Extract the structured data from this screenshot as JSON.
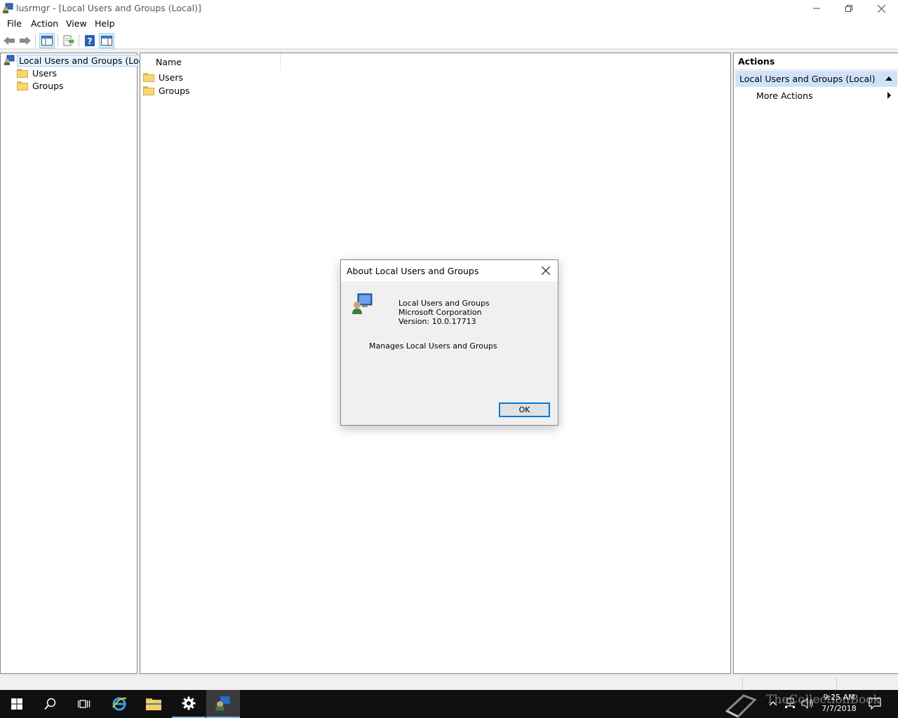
{
  "window": {
    "title": "lusrmgr - [Local Users and Groups (Local)]",
    "icon": "lusrmgr-app-icon"
  },
  "menu": [
    "File",
    "Action",
    "View",
    "Help"
  ],
  "toolbar": {
    "buttons": [
      "back-arrow-icon",
      "forward-arrow-icon",
      "show-hide-console-tree-icon",
      "export-list-icon",
      "help-icon",
      "show-hide-action-pane-icon"
    ]
  },
  "tree": {
    "root": "Local Users and Groups (Local)",
    "children": [
      "Users",
      "Groups"
    ]
  },
  "list": {
    "column": "Name",
    "items": [
      "Users",
      "Groups"
    ]
  },
  "actions": {
    "header": "Actions",
    "section": "Local Users and Groups (Local)",
    "more": "More Actions"
  },
  "dialog": {
    "title": "About Local Users and Groups",
    "product": "Local Users and Groups",
    "company": "Microsoft Corporation",
    "version": "Version: 10.0.17713",
    "description": "Manages Local Users and Groups",
    "ok": "OK"
  },
  "taskbar": {
    "time": "9:25 AM",
    "date": "7/7/2018",
    "watermark": "TheCollectionBook"
  },
  "colors": {
    "accent": "#0078d7",
    "selection": "#cfe3f7",
    "taskbar": "#101010"
  }
}
